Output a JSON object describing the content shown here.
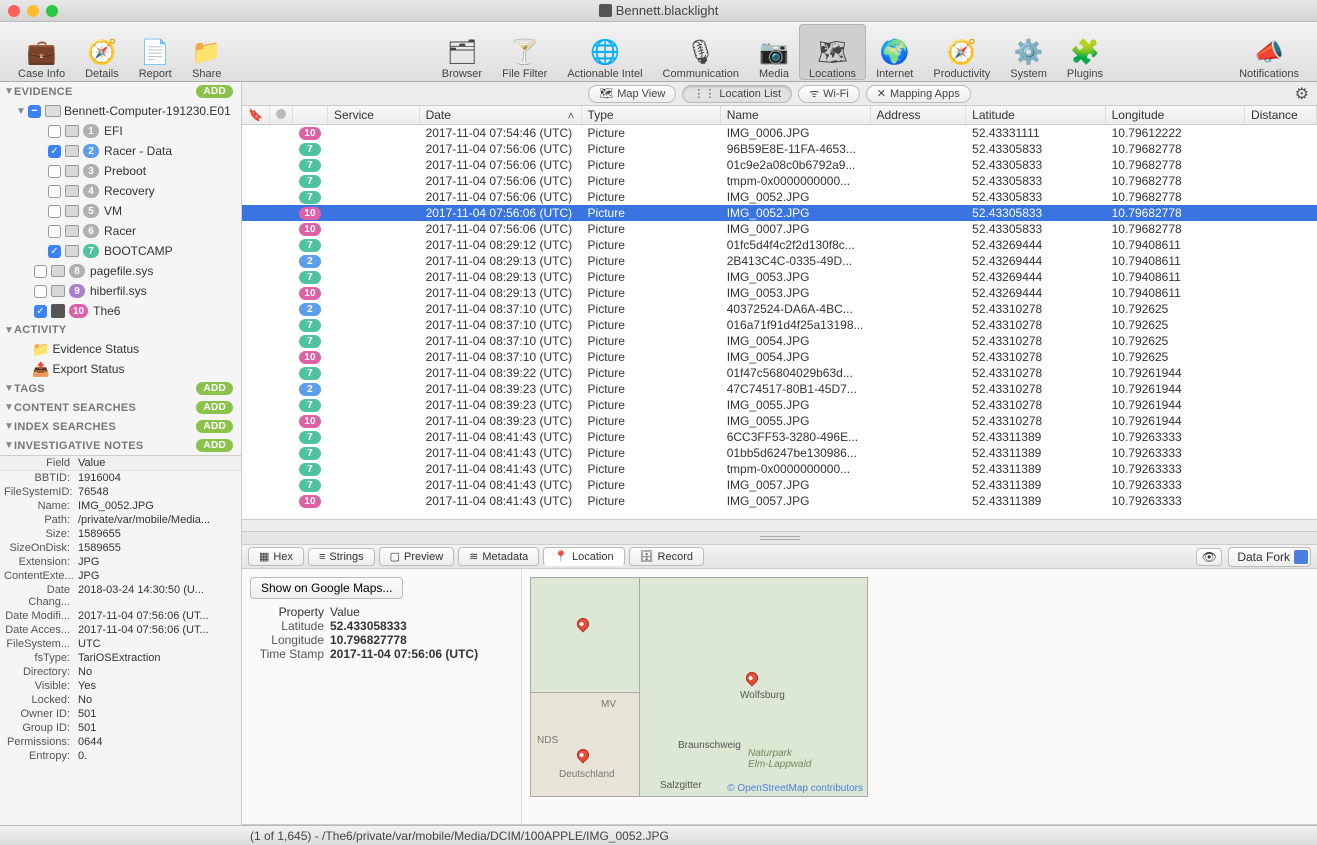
{
  "window": {
    "title": "Bennett.blacklight"
  },
  "toolbar": {
    "left": [
      {
        "id": "case-info",
        "label": "Case Info",
        "icon": "💼"
      },
      {
        "id": "details",
        "label": "Details",
        "icon": "🧭"
      },
      {
        "id": "report",
        "label": "Report",
        "icon": "📄"
      },
      {
        "id": "share",
        "label": "Share",
        "icon": "📁"
      }
    ],
    "center": [
      {
        "id": "browser",
        "label": "Browser",
        "icon": "🗂"
      },
      {
        "id": "file-filter",
        "label": "File Filter",
        "icon": "🍸"
      },
      {
        "id": "actionable-intel",
        "label": "Actionable Intel",
        "icon": "🌐"
      },
      {
        "id": "communication",
        "label": "Communication",
        "icon": "🎙"
      },
      {
        "id": "media",
        "label": "Media",
        "icon": "📷"
      },
      {
        "id": "locations",
        "label": "Locations",
        "icon": "🗺",
        "selected": true
      },
      {
        "id": "internet",
        "label": "Internet",
        "icon": "🌍"
      },
      {
        "id": "productivity",
        "label": "Productivity",
        "icon": "🧭"
      },
      {
        "id": "system",
        "label": "System",
        "icon": "⚙️"
      },
      {
        "id": "plugins",
        "label": "Plugins",
        "icon": "🧩"
      }
    ],
    "right": [
      {
        "id": "notifications",
        "label": "Notifications",
        "icon": "📣"
      }
    ]
  },
  "sidebar": {
    "evidence": {
      "label": "EVIDENCE",
      "add": "Add",
      "root": {
        "label": "Bennett-Computer-191230.E01"
      },
      "volumes": [
        {
          "num": "1",
          "label": "EFI",
          "checked": false,
          "color": "nb-grey"
        },
        {
          "num": "2",
          "label": "Racer - Data",
          "checked": true,
          "color": "nb-blue"
        },
        {
          "num": "3",
          "label": "Preboot",
          "checked": false,
          "color": "nb-grey"
        },
        {
          "num": "4",
          "label": "Recovery",
          "checked": false,
          "color": "nb-grey"
        },
        {
          "num": "5",
          "label": "VM",
          "checked": false,
          "color": "nb-grey"
        },
        {
          "num": "6",
          "label": "Racer",
          "checked": false,
          "color": "nb-grey"
        },
        {
          "num": "7",
          "label": "BOOTCAMP",
          "checked": true,
          "color": "nb-teal"
        }
      ],
      "files": [
        {
          "num": "8",
          "label": "pagefile.sys",
          "checked": false,
          "color": "nb-grey"
        },
        {
          "num": "9",
          "label": "hiberfil.sys",
          "checked": false,
          "color": "nb-purple"
        }
      ],
      "device": {
        "num": "10",
        "label": "The6",
        "checked": true,
        "color": "nb-pink"
      }
    },
    "activity": {
      "label": "ACTIVITY",
      "items": [
        {
          "label": "Evidence Status",
          "icon": "📁"
        },
        {
          "label": "Export Status",
          "icon": "📤"
        }
      ]
    },
    "sections": [
      {
        "label": "TAGS",
        "add": "Add"
      },
      {
        "label": "CONTENT SEARCHES",
        "add": "Add"
      },
      {
        "label": "INDEX SEARCHES",
        "add": "Add"
      },
      {
        "label": "INVESTIGATIVE NOTES",
        "add": "Add"
      }
    ]
  },
  "props_header": {
    "field": "Field",
    "value": "Value"
  },
  "props": [
    {
      "k": "BBTID:",
      "v": "1916004"
    },
    {
      "k": "FileSystemID:",
      "v": "76548"
    },
    {
      "k": "Name:",
      "v": "IMG_0052.JPG"
    },
    {
      "k": "Path:",
      "v": "/private/var/mobile/Media..."
    },
    {
      "k": "Size:",
      "v": "1589655"
    },
    {
      "k": "SizeOnDisk:",
      "v": "1589655"
    },
    {
      "k": "Extension:",
      "v": "JPG"
    },
    {
      "k": "ContentExte...",
      "v": "JPG"
    },
    {
      "k": "Date Chang...",
      "v": "2018-03-24 14:30:50 (U..."
    },
    {
      "k": "Date Modifi...",
      "v": "2017-11-04 07:56:06 (UT..."
    },
    {
      "k": "Date Acces...",
      "v": "2017-11-04 07:56:06 (UT..."
    },
    {
      "k": "FileSystem...",
      "v": "UTC"
    },
    {
      "k": "fsType:",
      "v": "TariOSExtraction"
    },
    {
      "k": "Directory:",
      "v": "No"
    },
    {
      "k": "Visible:",
      "v": "Yes"
    },
    {
      "k": "Locked:",
      "v": "No"
    },
    {
      "k": "Owner ID:",
      "v": "501"
    },
    {
      "k": "Group ID:",
      "v": "501"
    },
    {
      "k": "Permissions:",
      "v": "0644"
    },
    {
      "k": "Entropy:",
      "v": "0."
    }
  ],
  "viewbar": {
    "map_view": "Map View",
    "location_list": "Location List",
    "wifi": "Wi-Fi",
    "mapping_apps": "Mapping Apps"
  },
  "columns": {
    "service": "Service",
    "date": "Date",
    "type": "Type",
    "name": "Name",
    "address": "Address",
    "latitude": "Latitude",
    "longitude": "Longitude",
    "distance": "Distance"
  },
  "rows": [
    {
      "b": "10",
      "bc": "rb-pink",
      "date": "2017-11-04 07:54:46 (UTC)",
      "type": "Picture",
      "name": "IMG_0006.JPG",
      "lat": "52.43331111",
      "lon": "10.79612222"
    },
    {
      "b": "7",
      "bc": "rb-teal",
      "date": "2017-11-04 07:56:06 (UTC)",
      "type": "Picture",
      "name": "96B59E8E-11FA-4653...",
      "lat": "52.43305833",
      "lon": "10.79682778"
    },
    {
      "b": "7",
      "bc": "rb-teal",
      "date": "2017-11-04 07:56:06 (UTC)",
      "type": "Picture",
      "name": "01c9e2a08c0b6792a9...",
      "lat": "52.43305833",
      "lon": "10.79682778"
    },
    {
      "b": "7",
      "bc": "rb-teal",
      "date": "2017-11-04 07:56:06 (UTC)",
      "type": "Picture",
      "name": "tmpm-0x0000000000...",
      "lat": "52.43305833",
      "lon": "10.79682778"
    },
    {
      "b": "7",
      "bc": "rb-teal",
      "date": "2017-11-04 07:56:06 (UTC)",
      "type": "Picture",
      "name": "IMG_0052.JPG",
      "lat": "52.43305833",
      "lon": "10.79682778"
    },
    {
      "b": "10",
      "bc": "rb-pink",
      "date": "2017-11-04 07:56:06 (UTC)",
      "type": "Picture",
      "name": "IMG_0052.JPG",
      "lat": "52.43305833",
      "lon": "10.79682778",
      "sel": true
    },
    {
      "b": "10",
      "bc": "rb-pink",
      "date": "2017-11-04 07:56:06 (UTC)",
      "type": "Picture",
      "name": "IMG_0007.JPG",
      "lat": "52.43305833",
      "lon": "10.79682778"
    },
    {
      "b": "7",
      "bc": "rb-teal",
      "date": "2017-11-04 08:29:12 (UTC)",
      "type": "Picture",
      "name": "01fc5d4f4c2f2d130f8c...",
      "lat": "52.43269444",
      "lon": "10.79408611"
    },
    {
      "b": "2",
      "bc": "rb-blue",
      "date": "2017-11-04 08:29:13 (UTC)",
      "type": "Picture",
      "name": "2B413C4C-0335-49D...",
      "lat": "52.43269444",
      "lon": "10.79408611"
    },
    {
      "b": "7",
      "bc": "rb-teal",
      "date": "2017-11-04 08:29:13 (UTC)",
      "type": "Picture",
      "name": "IMG_0053.JPG",
      "lat": "52.43269444",
      "lon": "10.79408611"
    },
    {
      "b": "10",
      "bc": "rb-pink",
      "date": "2017-11-04 08:29:13 (UTC)",
      "type": "Picture",
      "name": "IMG_0053.JPG",
      "lat": "52.43269444",
      "lon": "10.79408611"
    },
    {
      "b": "2",
      "bc": "rb-blue",
      "date": "2017-11-04 08:37:10 (UTC)",
      "type": "Picture",
      "name": "40372524-DA6A-4BC...",
      "lat": "52.43310278",
      "lon": "10.792625"
    },
    {
      "b": "7",
      "bc": "rb-teal",
      "date": "2017-11-04 08:37:10 (UTC)",
      "type": "Picture",
      "name": "016a71f91d4f25a13198...",
      "lat": "52.43310278",
      "lon": "10.792625"
    },
    {
      "b": "7",
      "bc": "rb-teal",
      "date": "2017-11-04 08:37:10 (UTC)",
      "type": "Picture",
      "name": "IMG_0054.JPG",
      "lat": "52.43310278",
      "lon": "10.792625"
    },
    {
      "b": "10",
      "bc": "rb-pink",
      "date": "2017-11-04 08:37:10 (UTC)",
      "type": "Picture",
      "name": "IMG_0054.JPG",
      "lat": "52.43310278",
      "lon": "10.792625"
    },
    {
      "b": "7",
      "bc": "rb-teal",
      "date": "2017-11-04 08:39:22 (UTC)",
      "type": "Picture",
      "name": "01f47c56804029b63d...",
      "lat": "52.43310278",
      "lon": "10.79261944"
    },
    {
      "b": "2",
      "bc": "rb-blue",
      "date": "2017-11-04 08:39:23 (UTC)",
      "type": "Picture",
      "name": "47C74517-80B1-45D7...",
      "lat": "52.43310278",
      "lon": "10.79261944"
    },
    {
      "b": "7",
      "bc": "rb-teal",
      "date": "2017-11-04 08:39:23 (UTC)",
      "type": "Picture",
      "name": "IMG_0055.JPG",
      "lat": "52.43310278",
      "lon": "10.79261944"
    },
    {
      "b": "10",
      "bc": "rb-pink",
      "date": "2017-11-04 08:39:23 (UTC)",
      "type": "Picture",
      "name": "IMG_0055.JPG",
      "lat": "52.43310278",
      "lon": "10.79261944"
    },
    {
      "b": "7",
      "bc": "rb-teal",
      "date": "2017-11-04 08:41:43 (UTC)",
      "type": "Picture",
      "name": "6CC3FF53-3280-496E...",
      "lat": "52.43311389",
      "lon": "10.79263333"
    },
    {
      "b": "7",
      "bc": "rb-teal",
      "date": "2017-11-04 08:41:43 (UTC)",
      "type": "Picture",
      "name": "01bb5d6247be130986...",
      "lat": "52.43311389",
      "lon": "10.79263333"
    },
    {
      "b": "7",
      "bc": "rb-teal",
      "date": "2017-11-04 08:41:43 (UTC)",
      "type": "Picture",
      "name": "tmpm-0x0000000000...",
      "lat": "52.43311389",
      "lon": "10.79263333"
    },
    {
      "b": "7",
      "bc": "rb-teal",
      "date": "2017-11-04 08:41:43 (UTC)",
      "type": "Picture",
      "name": "IMG_0057.JPG",
      "lat": "52.43311389",
      "lon": "10.79263333"
    },
    {
      "b": "10",
      "bc": "rb-pink",
      "date": "2017-11-04 08:41:43 (UTC)",
      "type": "Picture",
      "name": "IMG_0057.JPG",
      "lat": "52.43311389",
      "lon": "10.79263333"
    }
  ],
  "detail_tabs": {
    "hex": "Hex",
    "strings": "Strings",
    "preview": "Preview",
    "metadata": "Metadata",
    "location": "Location",
    "record": "Record",
    "data_fork": "Data Fork"
  },
  "google_maps_btn": "Show on Google Maps...",
  "loc_header": {
    "prop": "Property",
    "val": "Value"
  },
  "loc_props": [
    {
      "k": "Latitude",
      "v": "52.433058333"
    },
    {
      "k": "Longitude",
      "v": "10.796827778"
    },
    {
      "k": "Time Stamp",
      "v": "2017-11-04 07:56:06 (UTC)"
    }
  ],
  "map_labels": {
    "wolfsburg": "Wolfsburg",
    "braunschweig": "Braunschweig",
    "naturpark": "Naturpark\nElm-Lappwald",
    "salzgitter": "Salzgitter",
    "nds": "NDS",
    "deutschland": "Deutschland",
    "mv": "MV"
  },
  "osm": "© OpenStreetMap contributors",
  "status": "(1 of 1,645)   -   /The6/private/var/mobile/Media/DCIM/100APPLE/IMG_0052.JPG"
}
